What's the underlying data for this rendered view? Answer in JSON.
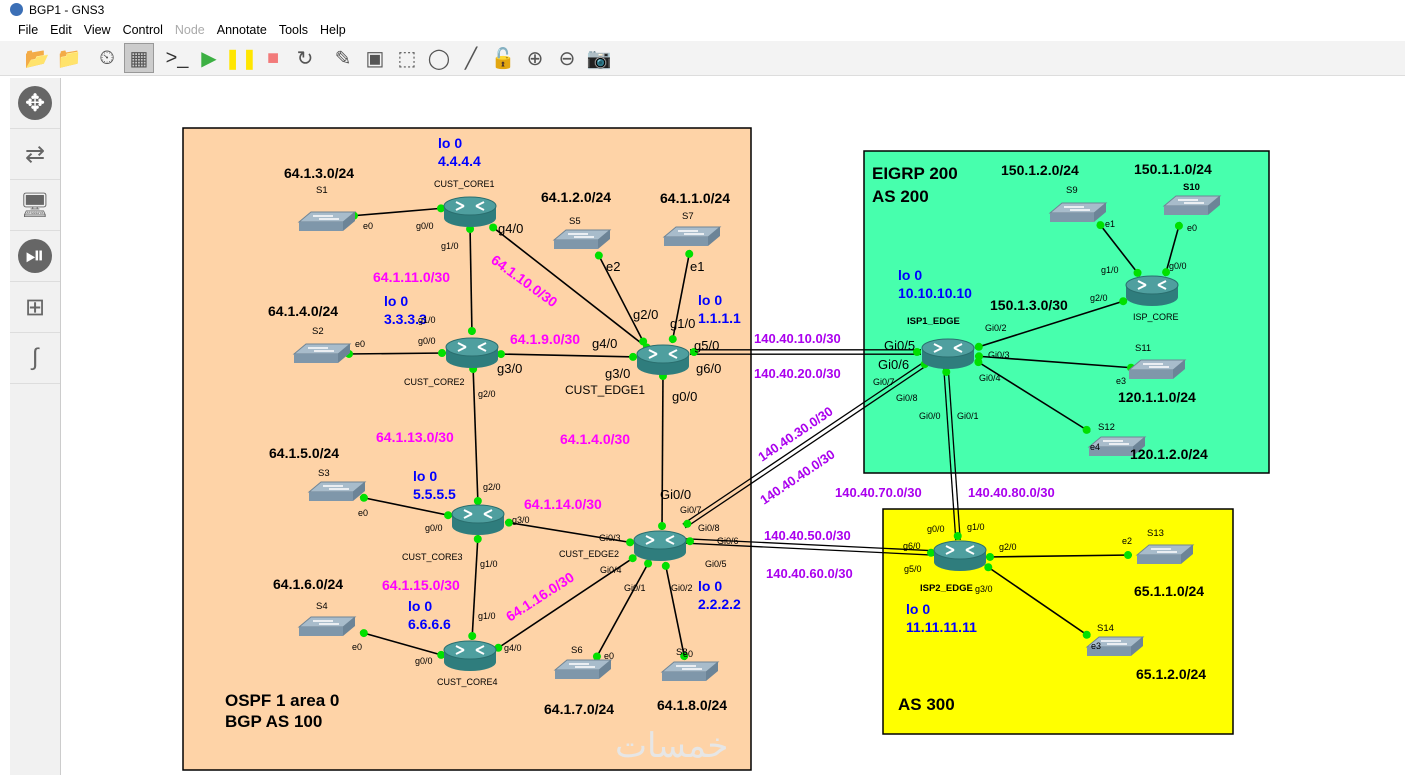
{
  "window": {
    "title": "BGP1 - GNS3"
  },
  "menu": [
    "File",
    "Edit",
    "View",
    "Control",
    "Node",
    "Annotate",
    "Tools",
    "Help"
  ],
  "toolbar": [
    "open-project-icon",
    "open-folder-icon",
    "snapshot-clock-icon",
    "show-interface-labels-icon",
    "console-icon",
    "start-icon",
    "pause-icon",
    "stop-icon",
    "reload-icon",
    "add-note-icon",
    "insert-picture-icon",
    "draw-rectangle-icon",
    "draw-ellipse-icon",
    "draw-line-icon",
    "lock-icon",
    "zoom-in-icon",
    "zoom-out-icon",
    "screenshot-icon"
  ],
  "sidebar": [
    "routers-icon",
    "switches-icon",
    "end-devices-icon",
    "security-devices-icon",
    "all-devices-icon",
    "add-link-icon"
  ],
  "colors": {
    "area_as100": "#fed3a7",
    "area_as200": "#47ffad",
    "area_as300": "#ffff00",
    "link_subnet": "#ff00ff",
    "inter_as_subnet": "#aa00ee",
    "loopback": "#0000ff",
    "port": "#00e000"
  },
  "areas": {
    "as100": [
      "OSPF 1 area 0",
      "BGP AS 100"
    ],
    "as200": [
      "EIGRP 200",
      "AS 200"
    ],
    "as300": [
      "AS 300"
    ]
  },
  "routers": {
    "core1": "CUST_CORE1",
    "core2": "CUST_CORE2",
    "edge1": "CUST_EDGE1",
    "core3": "CUST_CORE3",
    "core4": "CUST_CORE4",
    "edge2": "CUST_EDGE2",
    "isp1": "ISP1_EDGE",
    "ispcore": "ISP_CORE",
    "isp2": "ISP2_EDGE"
  },
  "switches": {
    "s1": "S1",
    "s2": "S2",
    "s3": "S3",
    "s4": "S4",
    "s5": "S5",
    "s6": "S6",
    "s7": "S7",
    "s8": "S8",
    "s9": "S9",
    "s10": "S10",
    "s11": "S11",
    "s12": "S12",
    "s13": "S13",
    "s14": "S14"
  },
  "lan_subnets": {
    "s1": "64.1.3.0/24",
    "s5": "64.1.2.0/24",
    "s7": "64.1.1.0/24",
    "s2": "64.1.4.0/24",
    "s3": "64.1.5.0/24",
    "s4": "64.1.6.0/24",
    "s6": "64.1.7.0/24",
    "s8": "64.1.8.0/24",
    "s9": "150.1.2.0/24",
    "s10": "150.1.1.0/24",
    "isp_link": "150.1.3.0/30",
    "s11": "120.1.1.0/24",
    "s12": "120.1.2.0/24",
    "s13": "65.1.1.0/24",
    "s14": "65.1.2.0/24"
  },
  "loopbacks": {
    "label": "lo 0",
    "core1": "4.4.4.4",
    "core2": "3.3.3.3",
    "edge1": "1.1.1.1",
    "core3": "5.5.5.5",
    "core4": "6.6.6.6",
    "edge2": "2.2.2.2",
    "isp1": "10.10.10.10",
    "isp2": "11.11.11.11"
  },
  "link_subnets": {
    "c1c2": "64.1.11.0/30",
    "c1e1": "64.1.10.0/30",
    "c2e1": "64.1.9.0/30",
    "c2c3": "64.1.13.0/30",
    "e1e2": "64.1.4.0/30",
    "c3e2": "64.1.14.0/30",
    "c3c4": "64.1.15.0/30",
    "c4e2": "64.1.16.0/30"
  },
  "inter_as": {
    "l10": "140.40.10.0/30",
    "l20": "140.40.20.0/30",
    "l30": "140.40.30.0/30",
    "l40": "140.40.40.0/30",
    "l50": "140.40.50.0/30",
    "l60": "140.40.60.0/30",
    "l70": "140.40.70.0/30",
    "l80": "140.40.80.0/30"
  },
  "ports": [
    "g0/0",
    "e0",
    "g1/0",
    "g4/0",
    "g1/0",
    "g0/0",
    "e0",
    "g3/0",
    "g2/0",
    "e2",
    "e1",
    "g2/0",
    "g1/0",
    "g4/0",
    "g5/0",
    "g6/0",
    "g3/0",
    "g0/0",
    "g2/0",
    "g0/0",
    "g3/0",
    "e0",
    "g1/0",
    "g1/0",
    "g0/0",
    "g4/0",
    "e0",
    "Gi0/0",
    "Gi0/7",
    "Gi0/8",
    "Gi0/6",
    "Gi0/5",
    "Gi0/3",
    "Gi0/4",
    "Gi0/1",
    "Gi0/2",
    "e0",
    "e0",
    "Gi0/5",
    "Gi0/6",
    "Gi0/7",
    "Gi0/8",
    "Gi0/0",
    "Gi0/1",
    "Gi0/2",
    "Gi0/3",
    "Gi0/4",
    "g1/0",
    "g0/0",
    "g2/0",
    "e1",
    "e0",
    "e3",
    "e4",
    "g0/0",
    "g1/0",
    "g6/0",
    "g5/0",
    "g2/0",
    "g3/0",
    "e2",
    "e3"
  ],
  "watermark": "خمسات"
}
